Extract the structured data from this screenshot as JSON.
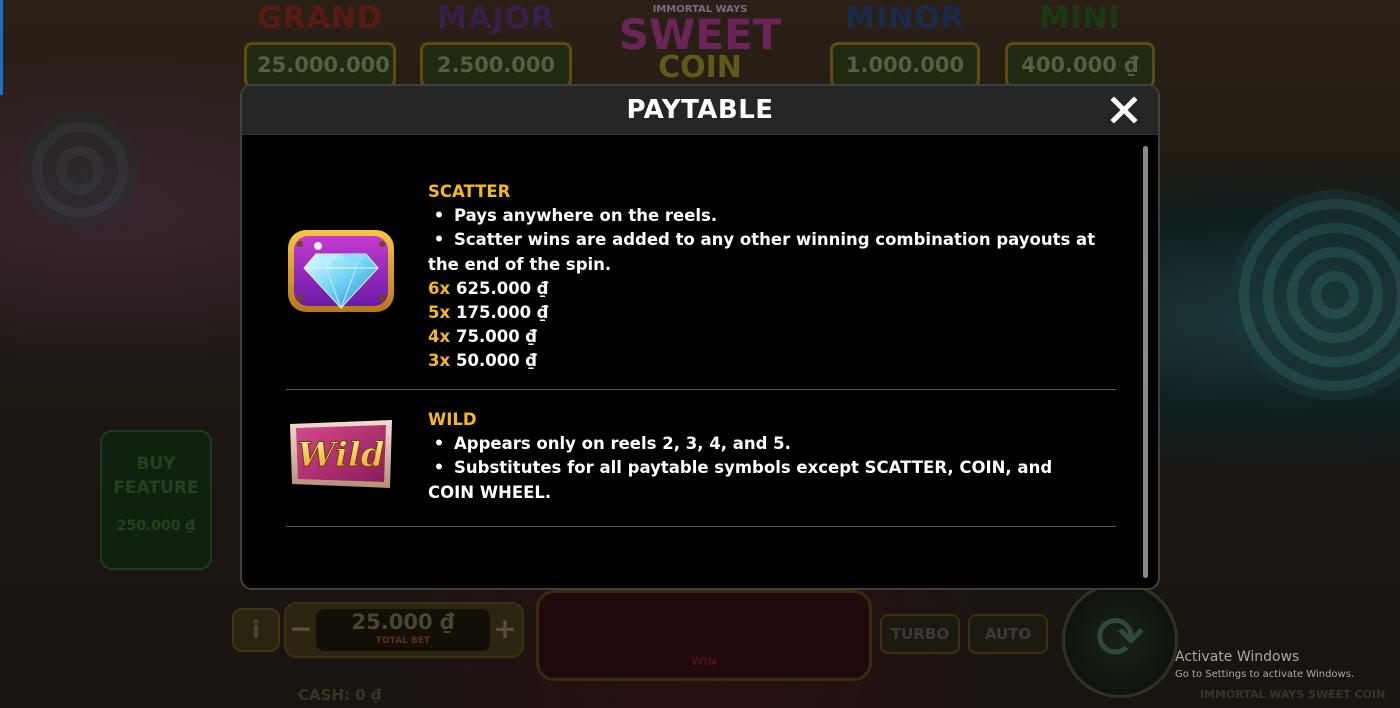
{
  "background": {
    "jackpots": [
      {
        "title": "GRAND",
        "amount": "25.000.000 ₫",
        "color": "#5a1a14"
      },
      {
        "title": "MAJOR",
        "amount": "2.500.000 ₫",
        "color": "#3a1e4a"
      },
      {
        "title": "MINOR",
        "amount": "1.000.000 ₫",
        "color": "#1a2a4a"
      },
      {
        "title": "MINI",
        "amount": "400.000 ₫",
        "color": "#1a3a14"
      }
    ],
    "logo": {
      "line1": "IMMORTAL WAYS",
      "line2": "SWEET",
      "line3": "COIN"
    },
    "buy_feature": {
      "line1": "BUY",
      "line2": "FEATURE",
      "amount": "250.000 ₫"
    },
    "bet": {
      "amount": "25.000 ₫",
      "label": "TOTAL BET"
    },
    "win_label": "WIN",
    "turbo_label": "TURBO",
    "auto_label": "AUTO",
    "cash_text": "CASH: 0 ₫",
    "game_name": "IMMORTAL WAYS SWEET COIN"
  },
  "modal": {
    "title": "PAYTABLE",
    "close_icon": "close-icon",
    "scatter": {
      "heading": "SCATTER",
      "bullets": [
        "Pays anywhere on the reels.",
        "Scatter wins are added to any other winning combination payouts at the end of the spin."
      ],
      "pays": [
        {
          "mult": "6x",
          "value": "625.000 ₫"
        },
        {
          "mult": "5x",
          "value": "175.000 ₫"
        },
        {
          "mult": "4x",
          "value": "75.000 ₫"
        },
        {
          "mult": "3x",
          "value": "50.000 ₫"
        }
      ],
      "icon": "diamond-icon"
    },
    "wild": {
      "heading": "WILD",
      "bullets": [
        "Appears only on reels 2, 3, 4, and 5.",
        "Substitutes for all paytable symbols except SCATTER, COIN, and COIN WHEEL."
      ],
      "symbol_text": "Wild",
      "icon": "wild-symbol-icon"
    }
  },
  "activation": {
    "line1": "Activate Windows",
    "line2": "Go to Settings to activate Windows."
  },
  "colors": {
    "accent": "#f5b820",
    "modal_bg": "#000000",
    "header_bg": "#262626"
  }
}
